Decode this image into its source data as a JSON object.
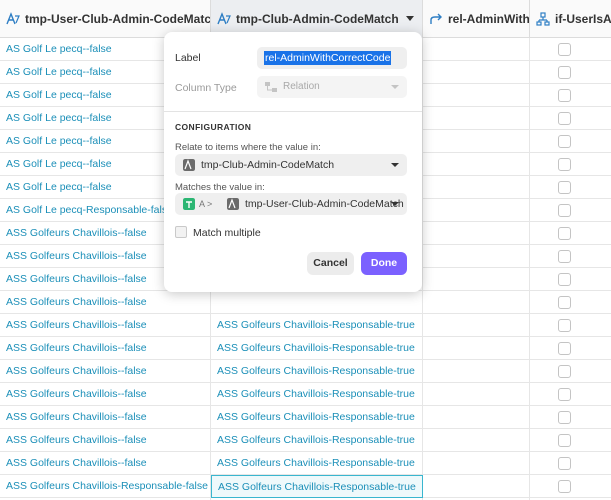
{
  "columns": [
    {
      "label": "tmp-User-Club-Admin-CodeMatch"
    },
    {
      "label": "tmp-Club-Admin-CodeMatch"
    },
    {
      "label": "rel-AdminWithCorr"
    },
    {
      "label": "if-UserIsAd"
    }
  ],
  "rows": [
    {
      "user_club": "AS Golf Le pecq--false",
      "club": ""
    },
    {
      "user_club": "AS Golf Le pecq--false",
      "club": ""
    },
    {
      "user_club": "AS Golf Le pecq--false",
      "club": ""
    },
    {
      "user_club": "AS Golf Le pecq--false",
      "club": ""
    },
    {
      "user_club": "AS Golf Le pecq--false",
      "club": ""
    },
    {
      "user_club": "AS Golf Le pecq--false",
      "club": ""
    },
    {
      "user_club": "AS Golf Le pecq--false",
      "club": ""
    },
    {
      "user_club": "AS Golf Le pecq-Responsable-false",
      "club": ""
    },
    {
      "user_club": "ASS Golfeurs Chavillois--false",
      "club": ""
    },
    {
      "user_club": "ASS Golfeurs Chavillois--false",
      "club": ""
    },
    {
      "user_club": "ASS Golfeurs Chavillois--false",
      "club": ""
    },
    {
      "user_club": "ASS Golfeurs Chavillois--false",
      "club": ""
    },
    {
      "user_club": "ASS Golfeurs Chavillois--false",
      "club": "ASS Golfeurs Chavillois-Responsable-true"
    },
    {
      "user_club": "ASS Golfeurs Chavillois--false",
      "club": "ASS Golfeurs Chavillois-Responsable-true"
    },
    {
      "user_club": "ASS Golfeurs Chavillois--false",
      "club": "ASS Golfeurs Chavillois-Responsable-true"
    },
    {
      "user_club": "ASS Golfeurs Chavillois--false",
      "club": "ASS Golfeurs Chavillois-Responsable-true"
    },
    {
      "user_club": "ASS Golfeurs Chavillois--false",
      "club": "ASS Golfeurs Chavillois-Responsable-true"
    },
    {
      "user_club": "ASS Golfeurs Chavillois--false",
      "club": "ASS Golfeurs Chavillois-Responsable-true"
    },
    {
      "user_club": "ASS Golfeurs Chavillois--false",
      "club": "ASS Golfeurs Chavillois-Responsable-true"
    },
    {
      "user_club": "ASS Golfeurs Chavillois-Responsable-false",
      "club": "ASS Golfeurs Chavillois-Responsable-true"
    },
    {
      "user_club": "ASS Golfeurs Chavillois--false",
      "club": "ASS Golfeurs Chavillois-Responsable-true"
    }
  ],
  "modal": {
    "label_caption": "Label",
    "label_value": "rel-AdminWithCorrectCode",
    "column_type_caption": "Column Type",
    "column_type_value": "Relation",
    "configuration_heading": "CONFIGURATION",
    "relate_caption": "Relate to items where the value in:",
    "relate_value": "tmp-Club-Admin-CodeMatch",
    "matches_caption": "Matches the value in:",
    "matches_prefix": "A >",
    "matches_value": "tmp-User-Club-Admin-CodeMatch",
    "match_multiple_label": "Match multiple",
    "cancel_label": "Cancel",
    "done_label": "Done"
  },
  "colors": {
    "link": "#1b8fb8",
    "done_button": "#7b61ff",
    "selection_highlight": "#1a73e8",
    "table_icon": "#2bb673"
  }
}
